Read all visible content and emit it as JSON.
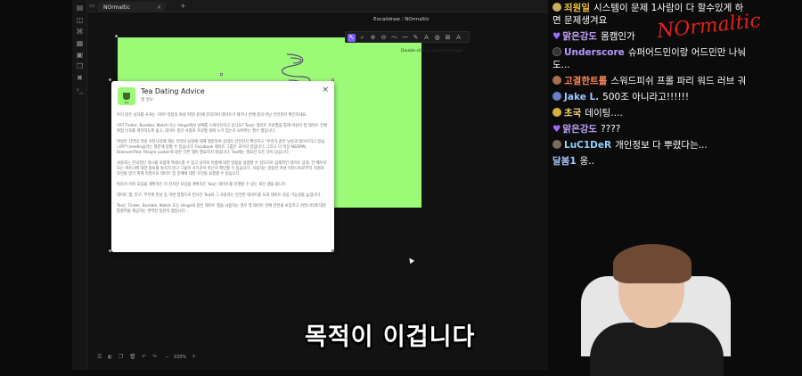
{
  "window": {
    "tab_title": "NOrmaltic",
    "new_tab": "+",
    "tab_close": "×",
    "breadcrumb_parent": "Excalidraw",
    "breadcrumb_sep": " / ",
    "breadcrumb_current": "NOrmaltic"
  },
  "canvas": {
    "hint": "Double-click to crop the image",
    "zoom": "100%"
  },
  "popup": {
    "title": "Tea Dating Advice",
    "subtitle": "앱 정보",
    "logo_label": "tea",
    "close": "×",
    "paragraphs": [
      "우리 같은 남자를 사귀는 거야? 악몽의 여성 커뮤니티에 문의하여 데이트가 제기나 연애 중의 아닌 안전한지 확인하세요.",
      "이미 Tinder, Bumble, Match 또는 Hinge에서 날짜를 스와이프하고 있나요? Tea는 데이트 프로필을 통해 여성이 첫 데이트 전에 위험 신호를 파악하도록 돕고, 데이트 중인 사람의 프로필 외에 누가 있는지 보여주는 필수 앱입니다.",
      "여성은 지역의 익명 커뮤니티에 해당 지역의 남성에 대해 질문하여 상대가 안전한지 확인하고 \"우리가 같은 남성과 데이트하고 있습니까?\"(seeding)라는 질문에 답할 수 있습니다. Facebook 데이트 그룹은 과거의 일입니다. 그리고 더 이상 NSOPW, BeenverifIed, People Looker와 같은 다른 앱이 필요하지 않습니다. Tea에는 필요한 모든 것이 있습니다.",
      "사용자는 전국적인 게시물 포럼에 액세스할 수 있고 남자의 이름에 대한 알림을 설정할 수 있으므로 잠재적인 데이트 상대, 전 배우자 또는 파트너에 대한 정보를 놓치지 않고 그들이 사기꾼이 아닌지 확인할 수 있습니다. 사용자는 검증된 여성 커뮤니티로부터 지원과 조언을 얻기 위해 익명으로 데이트 및 관계에 대한 조언을 요청할 수 있습니다.",
      "따라서 커피 모임을 계획하든 더 진지한 모임을 계획하든 Tea는 데이트를 진행할 수 있는 최신 앱을 줍니다.",
      "데이트 앱, 친구, 무작위 만남 등 어떤 방법으로 만나든 Tea와 그 사용자는 안전한 데이트를 도와 데이트 성공 가능성을 높입니다.",
      "Tea는 Tinder, Bumble, Match 또는 Hinge와 같은 데이트 앱을 사용하는 경우 첫 데이트 전에 안전을 보장하고 커뮤니티에 대한 통찰력을 제공하는 완벽한 동반자 앱입니다."
    ]
  },
  "subtitle_caption": "목적이 이겁니다",
  "chat": {
    "messages": [
      {
        "nick": "죄원일",
        "text": "시스템이 문제 1사람이 다 할수있게 하",
        "cont": "면 문제생겨요",
        "color": "#f0c040",
        "badge": "#c8b060"
      },
      {
        "nick": "맑은강도",
        "text": "몸캠인가",
        "color": "#c7a6ff",
        "badge": "heart"
      },
      {
        "nick": "Underscore",
        "text": "슈퍼어드민이랑 어드민만 나눠",
        "cont": "도...",
        "color": "#b89cff",
        "badge": "#333"
      },
      {
        "nick": "고결한트롤",
        "text": "스워드피쉬 프롤 파리 워드 러브 궈",
        "color": "#ff8a5c",
        "badge": "#a87050"
      },
      {
        "nick": "Jake L.",
        "text": "500조 아니라고!!!!!!",
        "color": "#9ec5ff",
        "badge": "#6a7fd0"
      },
      {
        "nick": "초국",
        "text": "데이팅....",
        "color": "#ffd76a",
        "badge": "#d9b040"
      },
      {
        "nick": "맑은강도",
        "text": "????",
        "color": "#c7a6ff",
        "badge": "heart"
      },
      {
        "nick": "LuC1DeR",
        "text": "개인정보 다 뿌렸다는...",
        "color": "#8fd1ff",
        "badge": "#7a6a60"
      },
      {
        "nick": "달봄1",
        "text": "옹..",
        "color": "#a9c7ff",
        "badge": ""
      }
    ],
    "watermark": "NOrmaltic"
  },
  "colors": {
    "canvas_bg": "#121212",
    "image_green": "#9bfb76",
    "accent": "#7b61ff"
  }
}
